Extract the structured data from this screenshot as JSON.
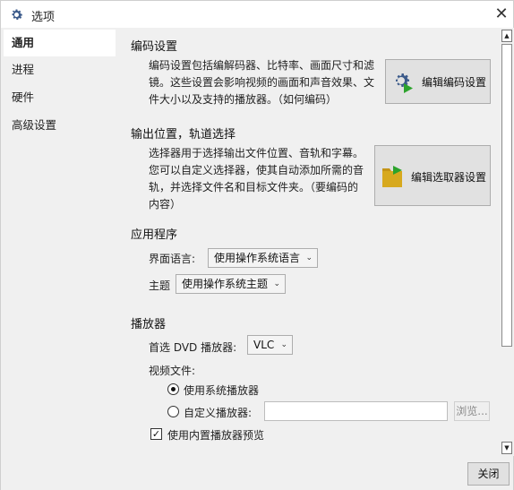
{
  "window": {
    "title": "选项"
  },
  "sidebar": {
    "items": [
      {
        "label": "通用"
      },
      {
        "label": "进程"
      },
      {
        "label": "硬件"
      },
      {
        "label": "高级设置"
      }
    ]
  },
  "encoding": {
    "title": "编码设置",
    "desc_lines": [
      "编码设置包括编解码器、比特率、画面尺寸和滤",
      "镜。这些设置会影响视频的画面和声音效果、文",
      "件大小以及支持的播放器。（如何编码）"
    ],
    "button_label": "编辑编码设置"
  },
  "output": {
    "title": "输出位置，轨道选择",
    "desc_lines": [
      "选择器用于选择输出文件位置、音轨和字幕。",
      "您可以自定义选择器，使其自动添加所需的音",
      "轨，并选择文件名和目标文件夹。（要编码的",
      "内容）"
    ],
    "button_label": "编辑选取器设置"
  },
  "app": {
    "title": "应用程序",
    "language_label": "界面语言:",
    "language_value": "使用操作系统语言",
    "theme_label": "主题",
    "theme_value": "使用操作系统主题"
  },
  "player": {
    "title": "播放器",
    "dvd_label": "首选 DVD 播放器:",
    "dvd_value": "VLC",
    "video_files_label": "视频文件:",
    "system_player_label": "使用系统播放器",
    "custom_player_label": "自定义播放器:",
    "custom_player_value": "",
    "browse_label": "浏览...",
    "preview_label": "使用内置播放器预览",
    "system_player_selected": true,
    "preview_checked": true
  },
  "footer": {
    "close_label": "关闭"
  }
}
